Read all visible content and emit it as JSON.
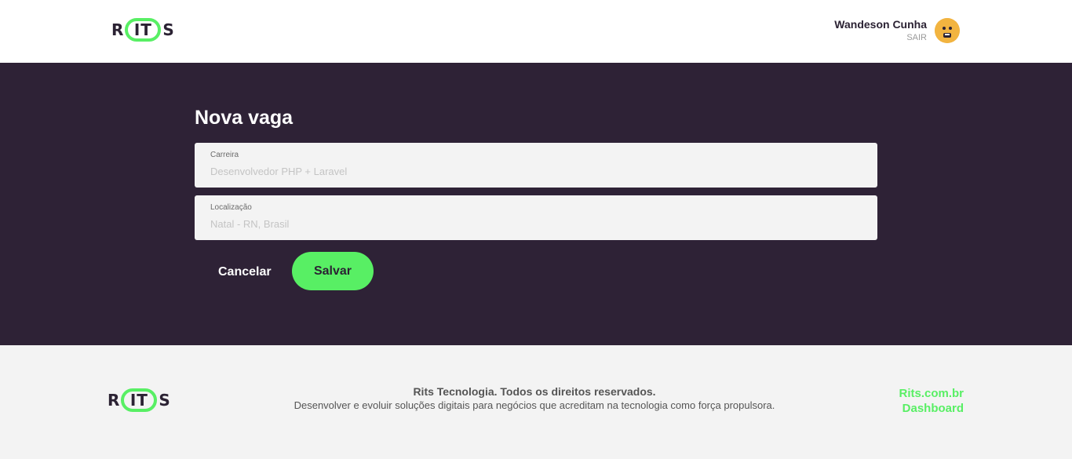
{
  "header": {
    "logo": {
      "left": "R",
      "middle": "IT",
      "right": "S"
    },
    "user": {
      "name": "Wandeson Cunha",
      "logout_label": "SAIR"
    }
  },
  "main": {
    "title": "Nova vaga",
    "fields": {
      "career": {
        "label": "Carreira",
        "placeholder": "Desenvolvedor PHP + Laravel",
        "value": ""
      },
      "location": {
        "label": "Localização",
        "placeholder": "Natal - RN, Brasil",
        "value": ""
      }
    },
    "actions": {
      "cancel_label": "Cancelar",
      "save_label": "Salvar"
    }
  },
  "footer": {
    "logo": {
      "left": "R",
      "middle": "IT",
      "right": "S"
    },
    "copyright": "Rits Tecnologia. Todos os direitos reservados.",
    "tagline": "Desenvolver e evoluir soluções digitais para negócios que acreditam na tecnologia como força propulsora.",
    "links": [
      "Rits.com.br",
      "Dashboard"
    ]
  },
  "colors": {
    "accent": "#58ef64",
    "dark_bg": "#2e2236",
    "light_bg": "#f3f3f3",
    "avatar": "#f2b440"
  }
}
